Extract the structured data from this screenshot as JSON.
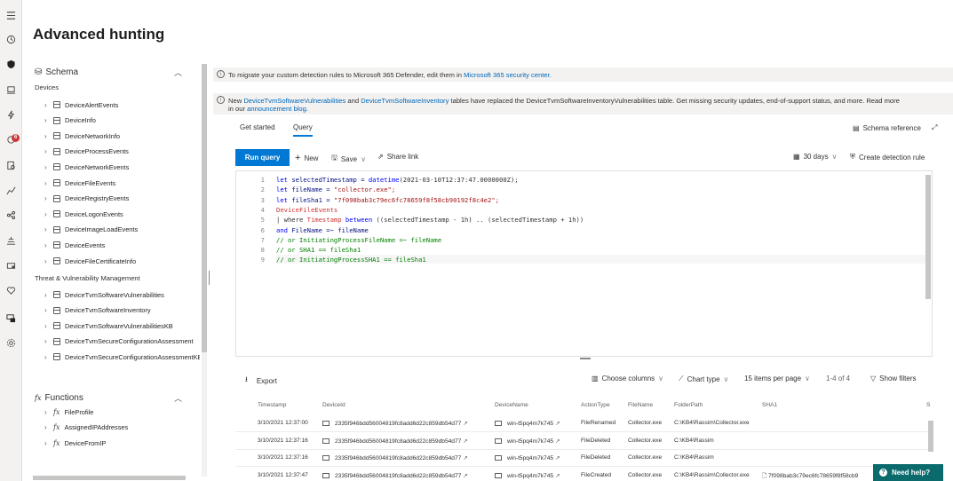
{
  "nav": {
    "items": [
      "menu-icon",
      "home-icon",
      "shield-icon",
      "devices-icon",
      "incidents-icon",
      "alerts-icon",
      "hunting-icon",
      "reports-icon",
      "partners-icon",
      "evaluation-icon",
      "learning-icon",
      "health-icon",
      "permissions-icon",
      "settings-icon"
    ],
    "alerts_badge": "6"
  },
  "page_title": "Advanced hunting",
  "schema": {
    "title": "Schema",
    "devices_group": "Devices",
    "devices_tables": [
      "DeviceAlertEvents",
      "DeviceInfo",
      "DeviceNetworkInfo",
      "DeviceProcessEvents",
      "DeviceNetworkEvents",
      "DeviceFileEvents",
      "DeviceRegistryEvents",
      "DeviceLogonEvents",
      "DeviceImageLoadEvents",
      "DeviceEvents",
      "DeviceFileCertificateInfo"
    ],
    "tvm_group": "Threat & Vulnerability Management",
    "tvm_tables": [
      "DeviceTvmSoftwareVulnerabilities",
      "DeviceTvmSoftwareInventory",
      "DeviceTvmSoftwareVulnerabilitiesKB",
      "DeviceTvmSecureConfigurationAssessment",
      "DeviceTvmSecureConfigurationAssessmentKB"
    ],
    "functions_title": "Functions",
    "functions": [
      "FileProfile",
      "AssignedIPAddresses",
      "DeviceFromIP"
    ]
  },
  "banner1": {
    "text": "To migrate your custom detection rules to Microsoft 365 Defender, edit them in",
    "link": "Microsoft 365 security center."
  },
  "banner2": {
    "pre": "New",
    "link1": "DeviceTvmSoftwareVulnerabilities",
    "and": "and",
    "link2": "DeviceTvmSoftwareInventory",
    "text": "tables have replaced the DeviceTvmSoftwareInventoryVulnerabilities table. Get missing security updates, end-of-support status, and more. Read more",
    "in_our": "in our",
    "link3": "announcement blog."
  },
  "tabs": {
    "get_started": "Get started",
    "query": "Query"
  },
  "schema_reference": "Schema reference",
  "toolbar": {
    "run_query": "Run query",
    "new": "New",
    "save": "Save",
    "share_link": "Share link",
    "time_range": "30 days",
    "create_rule": "Create detection rule"
  },
  "code": [
    {
      "n": "1",
      "a": "let ",
      "b": "selectedTimestamp = ",
      "c": "datetime",
      "d": "(2021-03-10T12:37:47.0000000Z);"
    },
    {
      "n": "2",
      "a": "let ",
      "b": "fileName = ",
      "c": "",
      "d": "\"collector.exe\";"
    },
    {
      "n": "3",
      "a": "let ",
      "b": "fileSha1 = ",
      "c": "",
      "d": "\"7f098bab3c79ec6fc78659f8f58cb90192f8c4e2\";"
    },
    {
      "n": "4",
      "a": "",
      "b": "",
      "c": "DeviceFileEvents",
      "d": ""
    },
    {
      "n": "5",
      "a": "| where ",
      "b": "Timestamp ",
      "c": "between",
      "d": " ((selectedTimestamp - 1h) .. (selectedTimestamp + 1h))"
    },
    {
      "n": "6",
      "a": "and ",
      "b": "FileName =~ fileName",
      "c": "",
      "d": ""
    },
    {
      "n": "7",
      "a": "// or InitiatingProcessFileName =~ fileName",
      "b": "",
      "c": "",
      "d": ""
    },
    {
      "n": "8",
      "a": "// or SHA1 == fileSha1",
      "b": "",
      "c": "",
      "d": ""
    },
    {
      "n": "9",
      "a": "// or InitiatingProcessSHA1 == fileSha1",
      "b": "",
      "c": "",
      "d": ""
    }
  ],
  "results_toolbar": {
    "export": "Export",
    "choose_columns": "Choose columns",
    "chart_type": "Chart type",
    "page_size": "15 items per page",
    "range": "1-4 of 4",
    "show_filters": "Show filters"
  },
  "table": {
    "columns": [
      "Timestamp",
      "DeviceId",
      "DeviceName",
      "ActionType",
      "FileName",
      "FolderPath",
      "SHA1"
    ],
    "rows": [
      {
        "Timestamp": "3/10/2021 12:37:00",
        "DeviceId": "2335f946bdd56004819fc8add6d22c859db54d77",
        "DeviceName": "win-t5pq4m7k745",
        "ActionType": "FileRenamed",
        "FileName": "Collector.exe",
        "FolderPath": "C:\\KB4\\Rassim\\Collector.exe",
        "SHA1": ""
      },
      {
        "Timestamp": "3/10/2021 12:37:16",
        "DeviceId": "2335f946bdd56004819fc8add6d22c859db54d77",
        "DeviceName": "win-t5pq4m7k745",
        "ActionType": "FileDeleted",
        "FileName": "Collector.exe",
        "FolderPath": "C:\\KB4\\Rassim",
        "SHA1": ""
      },
      {
        "Timestamp": "3/10/2021 12:37:16",
        "DeviceId": "2335f946bdd56004819fc8add6d22c859db54d77",
        "DeviceName": "win-t5pq4m7k745",
        "ActionType": "FileDeleted",
        "FileName": "Collector.exe",
        "FolderPath": "C:\\KB4\\Rassim",
        "SHA1": ""
      },
      {
        "Timestamp": "3/10/2021 12:37:47",
        "DeviceId": "2335f946bdd56004819fc8add6d22c859db54d77",
        "DeviceName": "win-t5pq4m7k745",
        "ActionType": "FileCreated",
        "FileName": "Collector.exe",
        "FolderPath": "C:\\KB4\\Rassim\\Collector.exe",
        "SHA1": "7f098bab3c79ec6fc78659f8f58cb9"
      }
    ]
  },
  "need_help": "Need help?"
}
